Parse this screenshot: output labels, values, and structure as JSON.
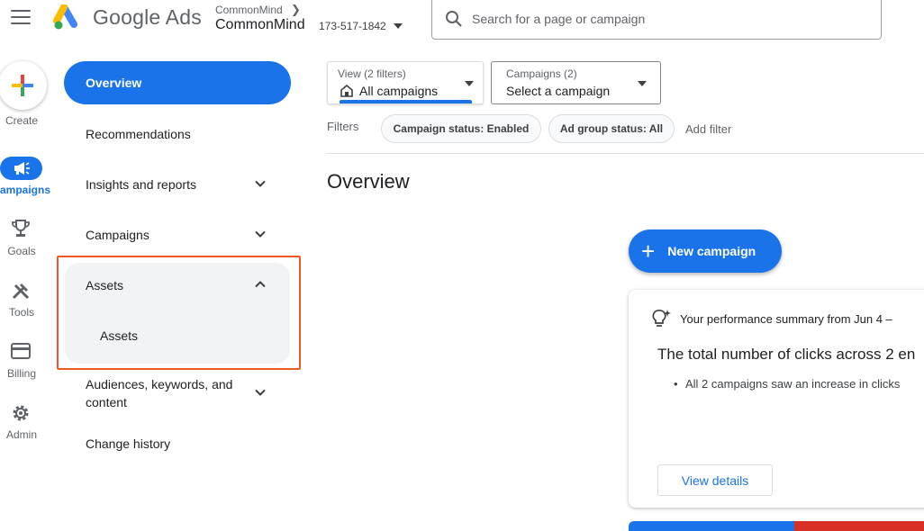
{
  "header": {
    "brand": "Google Ads",
    "account_parent": "CommonMind",
    "account_name": "CommonMind",
    "account_id": "173-517-1842",
    "search_placeholder": "Search for a page or campaign"
  },
  "rail": {
    "create": "Create",
    "campaigns": "ampaigns",
    "goals": "Goals",
    "tools": "Tools",
    "billing": "Billing",
    "admin": "Admin"
  },
  "nav": {
    "overview": "Overview",
    "recommendations": "Recommendations",
    "insights": "Insights and reports",
    "campaigns": "Campaigns",
    "assets": "Assets",
    "assets_sub": "Assets",
    "audiences_line1": "Audiences, keywords, and",
    "audiences_line2": "content",
    "change_history": "Change history"
  },
  "filters": {
    "view_small": "View (2 filters)",
    "view_main": "All campaigns",
    "campaigns_small": "Campaigns (2)",
    "campaigns_main": "Select a campaign",
    "label": "Filters",
    "chips": [
      "Campaign status: Enabled",
      "Ad group status: All"
    ],
    "add_filter": "Add filter"
  },
  "main": {
    "title": "Overview",
    "new_campaign": "New campaign",
    "card_heading": "Your performance summary from Jun 4 –",
    "card_main": "The total number of clicks across 2 en",
    "card_bullet": "All 2 campaigns saw an increase in clicks",
    "view_details": "View details"
  },
  "colors": {
    "accent": "#1a73e8",
    "highlight": "#f05a22",
    "red": "#d93025"
  }
}
